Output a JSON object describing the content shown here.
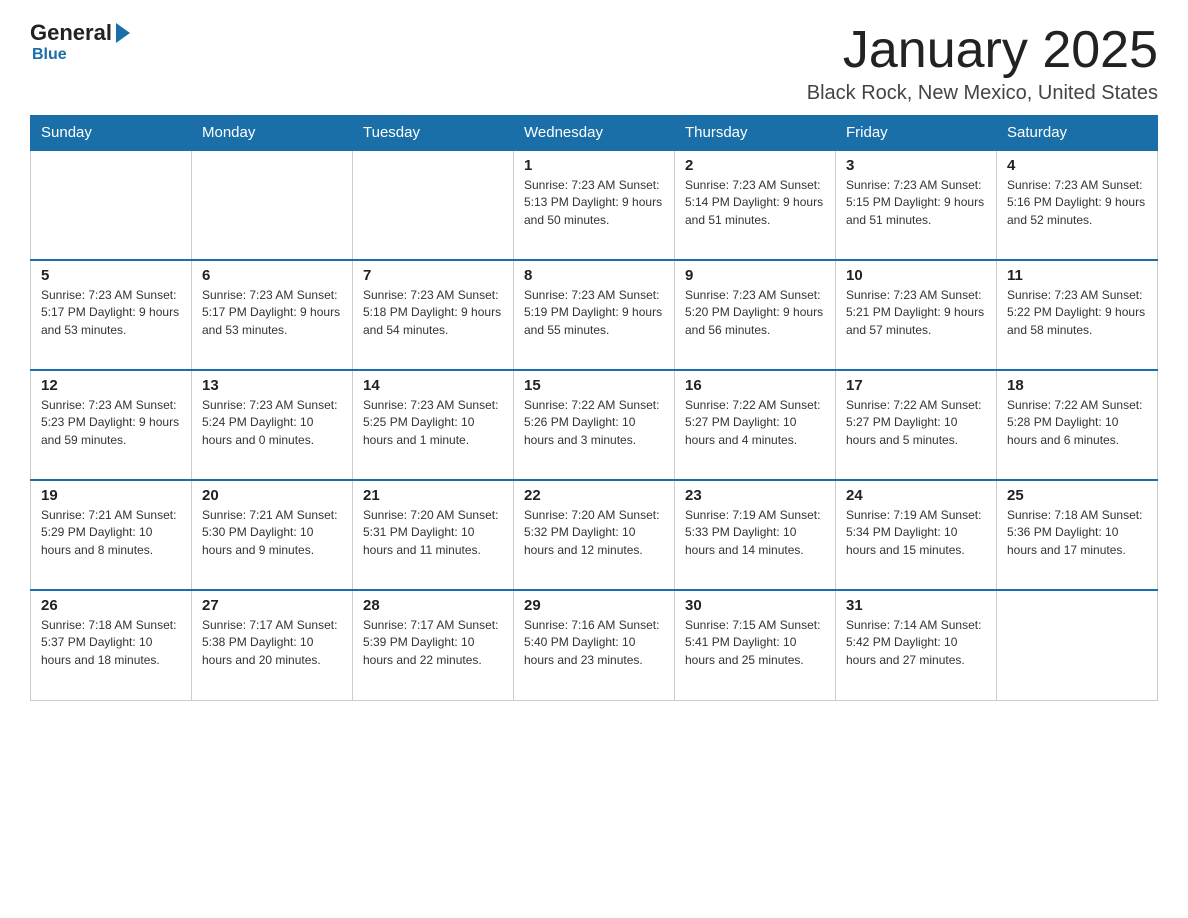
{
  "logo": {
    "general": "General",
    "blue": "Blue"
  },
  "title": "January 2025",
  "location": "Black Rock, New Mexico, United States",
  "days_of_week": [
    "Sunday",
    "Monday",
    "Tuesday",
    "Wednesday",
    "Thursday",
    "Friday",
    "Saturday"
  ],
  "weeks": [
    [
      {
        "day": "",
        "info": ""
      },
      {
        "day": "",
        "info": ""
      },
      {
        "day": "",
        "info": ""
      },
      {
        "day": "1",
        "info": "Sunrise: 7:23 AM\nSunset: 5:13 PM\nDaylight: 9 hours\nand 50 minutes."
      },
      {
        "day": "2",
        "info": "Sunrise: 7:23 AM\nSunset: 5:14 PM\nDaylight: 9 hours\nand 51 minutes."
      },
      {
        "day": "3",
        "info": "Sunrise: 7:23 AM\nSunset: 5:15 PM\nDaylight: 9 hours\nand 51 minutes."
      },
      {
        "day": "4",
        "info": "Sunrise: 7:23 AM\nSunset: 5:16 PM\nDaylight: 9 hours\nand 52 minutes."
      }
    ],
    [
      {
        "day": "5",
        "info": "Sunrise: 7:23 AM\nSunset: 5:17 PM\nDaylight: 9 hours\nand 53 minutes."
      },
      {
        "day": "6",
        "info": "Sunrise: 7:23 AM\nSunset: 5:17 PM\nDaylight: 9 hours\nand 53 minutes."
      },
      {
        "day": "7",
        "info": "Sunrise: 7:23 AM\nSunset: 5:18 PM\nDaylight: 9 hours\nand 54 minutes."
      },
      {
        "day": "8",
        "info": "Sunrise: 7:23 AM\nSunset: 5:19 PM\nDaylight: 9 hours\nand 55 minutes."
      },
      {
        "day": "9",
        "info": "Sunrise: 7:23 AM\nSunset: 5:20 PM\nDaylight: 9 hours\nand 56 minutes."
      },
      {
        "day": "10",
        "info": "Sunrise: 7:23 AM\nSunset: 5:21 PM\nDaylight: 9 hours\nand 57 minutes."
      },
      {
        "day": "11",
        "info": "Sunrise: 7:23 AM\nSunset: 5:22 PM\nDaylight: 9 hours\nand 58 minutes."
      }
    ],
    [
      {
        "day": "12",
        "info": "Sunrise: 7:23 AM\nSunset: 5:23 PM\nDaylight: 9 hours\nand 59 minutes."
      },
      {
        "day": "13",
        "info": "Sunrise: 7:23 AM\nSunset: 5:24 PM\nDaylight: 10 hours\nand 0 minutes."
      },
      {
        "day": "14",
        "info": "Sunrise: 7:23 AM\nSunset: 5:25 PM\nDaylight: 10 hours\nand 1 minute."
      },
      {
        "day": "15",
        "info": "Sunrise: 7:22 AM\nSunset: 5:26 PM\nDaylight: 10 hours\nand 3 minutes."
      },
      {
        "day": "16",
        "info": "Sunrise: 7:22 AM\nSunset: 5:27 PM\nDaylight: 10 hours\nand 4 minutes."
      },
      {
        "day": "17",
        "info": "Sunrise: 7:22 AM\nSunset: 5:27 PM\nDaylight: 10 hours\nand 5 minutes."
      },
      {
        "day": "18",
        "info": "Sunrise: 7:22 AM\nSunset: 5:28 PM\nDaylight: 10 hours\nand 6 minutes."
      }
    ],
    [
      {
        "day": "19",
        "info": "Sunrise: 7:21 AM\nSunset: 5:29 PM\nDaylight: 10 hours\nand 8 minutes."
      },
      {
        "day": "20",
        "info": "Sunrise: 7:21 AM\nSunset: 5:30 PM\nDaylight: 10 hours\nand 9 minutes."
      },
      {
        "day": "21",
        "info": "Sunrise: 7:20 AM\nSunset: 5:31 PM\nDaylight: 10 hours\nand 11 minutes."
      },
      {
        "day": "22",
        "info": "Sunrise: 7:20 AM\nSunset: 5:32 PM\nDaylight: 10 hours\nand 12 minutes."
      },
      {
        "day": "23",
        "info": "Sunrise: 7:19 AM\nSunset: 5:33 PM\nDaylight: 10 hours\nand 14 minutes."
      },
      {
        "day": "24",
        "info": "Sunrise: 7:19 AM\nSunset: 5:34 PM\nDaylight: 10 hours\nand 15 minutes."
      },
      {
        "day": "25",
        "info": "Sunrise: 7:18 AM\nSunset: 5:36 PM\nDaylight: 10 hours\nand 17 minutes."
      }
    ],
    [
      {
        "day": "26",
        "info": "Sunrise: 7:18 AM\nSunset: 5:37 PM\nDaylight: 10 hours\nand 18 minutes."
      },
      {
        "day": "27",
        "info": "Sunrise: 7:17 AM\nSunset: 5:38 PM\nDaylight: 10 hours\nand 20 minutes."
      },
      {
        "day": "28",
        "info": "Sunrise: 7:17 AM\nSunset: 5:39 PM\nDaylight: 10 hours\nand 22 minutes."
      },
      {
        "day": "29",
        "info": "Sunrise: 7:16 AM\nSunset: 5:40 PM\nDaylight: 10 hours\nand 23 minutes."
      },
      {
        "day": "30",
        "info": "Sunrise: 7:15 AM\nSunset: 5:41 PM\nDaylight: 10 hours\nand 25 minutes."
      },
      {
        "day": "31",
        "info": "Sunrise: 7:14 AM\nSunset: 5:42 PM\nDaylight: 10 hours\nand 27 minutes."
      },
      {
        "day": "",
        "info": ""
      }
    ]
  ]
}
